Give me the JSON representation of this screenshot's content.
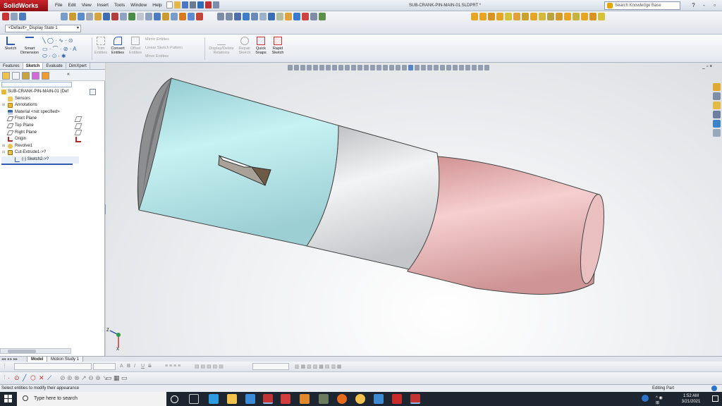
{
  "app": {
    "logo": "SolidWorks",
    "menu": [
      "File",
      "Edit",
      "View",
      "Insert",
      "Tools",
      "Window",
      "Help"
    ],
    "document_title": "SUB-CRANK-PIN-MAIN-01.SLDPRT *",
    "search_placeholder": "Search Knowledge Base",
    "window_controls": [
      "?",
      "-",
      "▫",
      "×"
    ]
  },
  "config": {
    "display_state": "<Default>_Display State 1"
  },
  "command_manager": {
    "tools": [
      {
        "label": "Sketch",
        "icon": "sketch-icon"
      },
      {
        "label": "Smart Dimension",
        "icon": "smart-dimension-icon"
      },
      {
        "label": "Trim Entities",
        "icon": "trim-icon"
      },
      {
        "label": "Convert Entities",
        "icon": "convert-icon"
      },
      {
        "label": "Offset Entities",
        "icon": "offset-icon"
      },
      {
        "label": "Mirror Entities",
        "icon": "mirror-icon"
      },
      {
        "label": "Linear Sketch Pattern",
        "icon": "pattern-icon"
      },
      {
        "label": "Move Entities",
        "icon": "move-icon"
      },
      {
        "label": "Display/Delete Relations",
        "icon": "relations-icon"
      },
      {
        "label": "Repair Sketch",
        "icon": "repair-icon"
      },
      {
        "label": "Quick Snaps",
        "icon": "snap-icon"
      },
      {
        "label": "Rapid Sketch",
        "icon": "rapid-icon"
      }
    ]
  },
  "feature_manager": {
    "tabs": [
      "Features",
      "Sketch",
      "Evaluate",
      "DimXpert"
    ],
    "active_tab": "Sketch",
    "part_name": "SUB-CRANK-PIN-MAIN-01  (Def",
    "items": [
      {
        "label": "Sensors",
        "icon": "sensor-icon"
      },
      {
        "label": "Annotations",
        "icon": "annotations-icon"
      },
      {
        "label": "Material <not specified>",
        "icon": "material-icon"
      },
      {
        "label": "Front Plane",
        "icon": "plane-icon"
      },
      {
        "label": "Top Plane",
        "icon": "plane-icon"
      },
      {
        "label": "Right Plane",
        "icon": "plane-icon"
      },
      {
        "label": "Origin",
        "icon": "origin-icon"
      },
      {
        "label": "Revolve1",
        "icon": "revolve-icon"
      },
      {
        "label": "Cut-Extrude1->?",
        "icon": "cut-extrude-icon"
      },
      {
        "label": "(-) Sketch2->?",
        "icon": "sketch-item-icon"
      }
    ]
  },
  "model": {
    "segments": [
      {
        "name": "cylinder-main",
        "color": "#b5e1e6"
      },
      {
        "name": "cylinder-collar",
        "color": "#d6d8da"
      },
      {
        "name": "cylinder-pin",
        "color": "#e2aeae"
      }
    ],
    "triad": [
      "Z",
      "X"
    ]
  },
  "bottom_tabs": [
    "Model",
    "Motion Study 1"
  ],
  "active_bottom_tab": "Model",
  "format_buttons": [
    "A",
    "B",
    "I",
    "U",
    "S"
  ],
  "status": {
    "message": "Select entities to modify their appearance",
    "mode": "Editing Part"
  },
  "taskbar": {
    "search_placeholder": "Type here to search",
    "time": "1:52 AM",
    "date": "3/21/2021"
  }
}
